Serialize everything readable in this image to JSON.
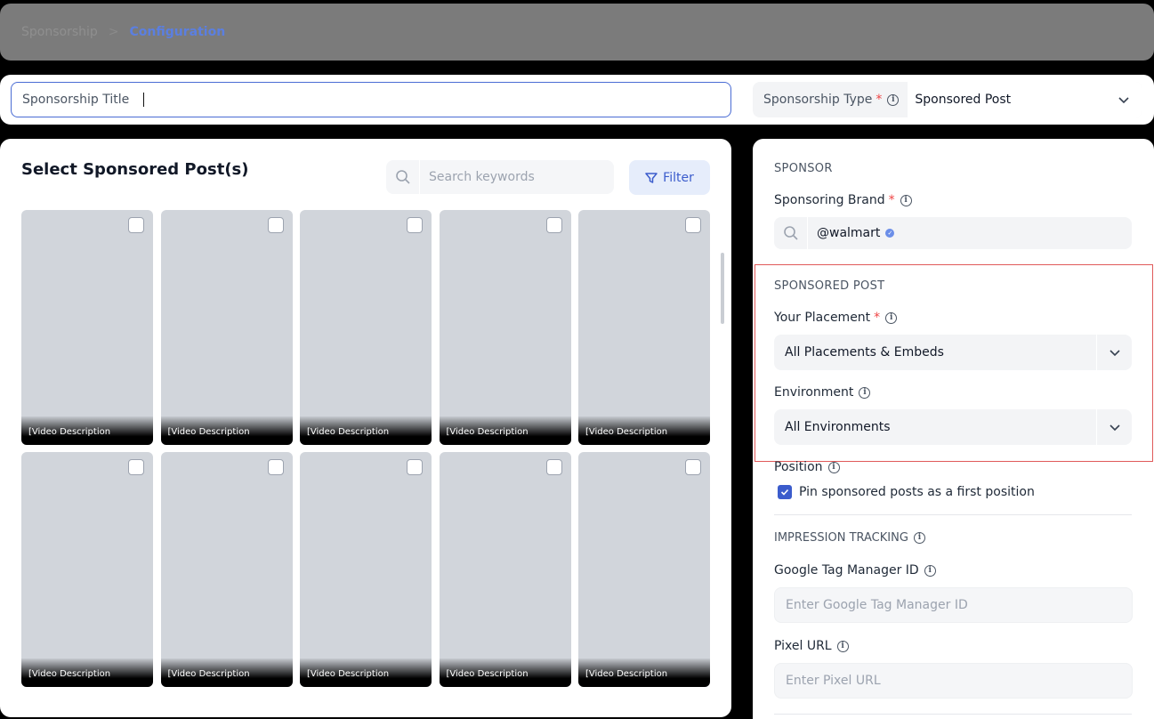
{
  "breadcrumb": {
    "parent": "Sponsorship",
    "separator": ">",
    "current": "Configuration"
  },
  "title_row": {
    "title_label": "Sponsorship Title",
    "type_label": "Sponsorship Type",
    "type_required": "*",
    "type_value": "Sponsored Post"
  },
  "left": {
    "title": "Select Sponsored Post(s)",
    "search_placeholder": "Search keywords",
    "filter_label": "Filter",
    "cards": [
      {
        "desc": "[Video Description"
      },
      {
        "desc": "[Video Description"
      },
      {
        "desc": "[Video Description"
      },
      {
        "desc": "[Video Description"
      },
      {
        "desc": "[Video Description"
      },
      {
        "desc": "[Video Description"
      },
      {
        "desc": "[Video Description"
      },
      {
        "desc": "[Video Description"
      },
      {
        "desc": "[Video Description"
      },
      {
        "desc": "[Video Description"
      }
    ]
  },
  "right": {
    "sponsor_section": "SPONSOR",
    "brand_label": "Sponsoring Brand",
    "brand_required": "*",
    "brand_value": "@walmart",
    "post_section": "SPONSORED POST",
    "placement_label": "Your Placement",
    "placement_required": "*",
    "placement_value": "All Placements & Embeds",
    "environment_label": "Environment",
    "environment_value": "All Environments",
    "position_label": "Position",
    "pin_label": "Pin sponsored posts as a first position",
    "tracking_section": "IMPRESSION TRACKING",
    "gtm_label": "Google Tag Manager ID",
    "gtm_placeholder": "Enter Google Tag Manager ID",
    "pixel_label": "Pixel URL",
    "pixel_placeholder": "Enter Pixel URL"
  },
  "colors": {
    "accent": "#3b5ccc",
    "highlight_border": "#e05a5a",
    "required": "#ef4444"
  }
}
